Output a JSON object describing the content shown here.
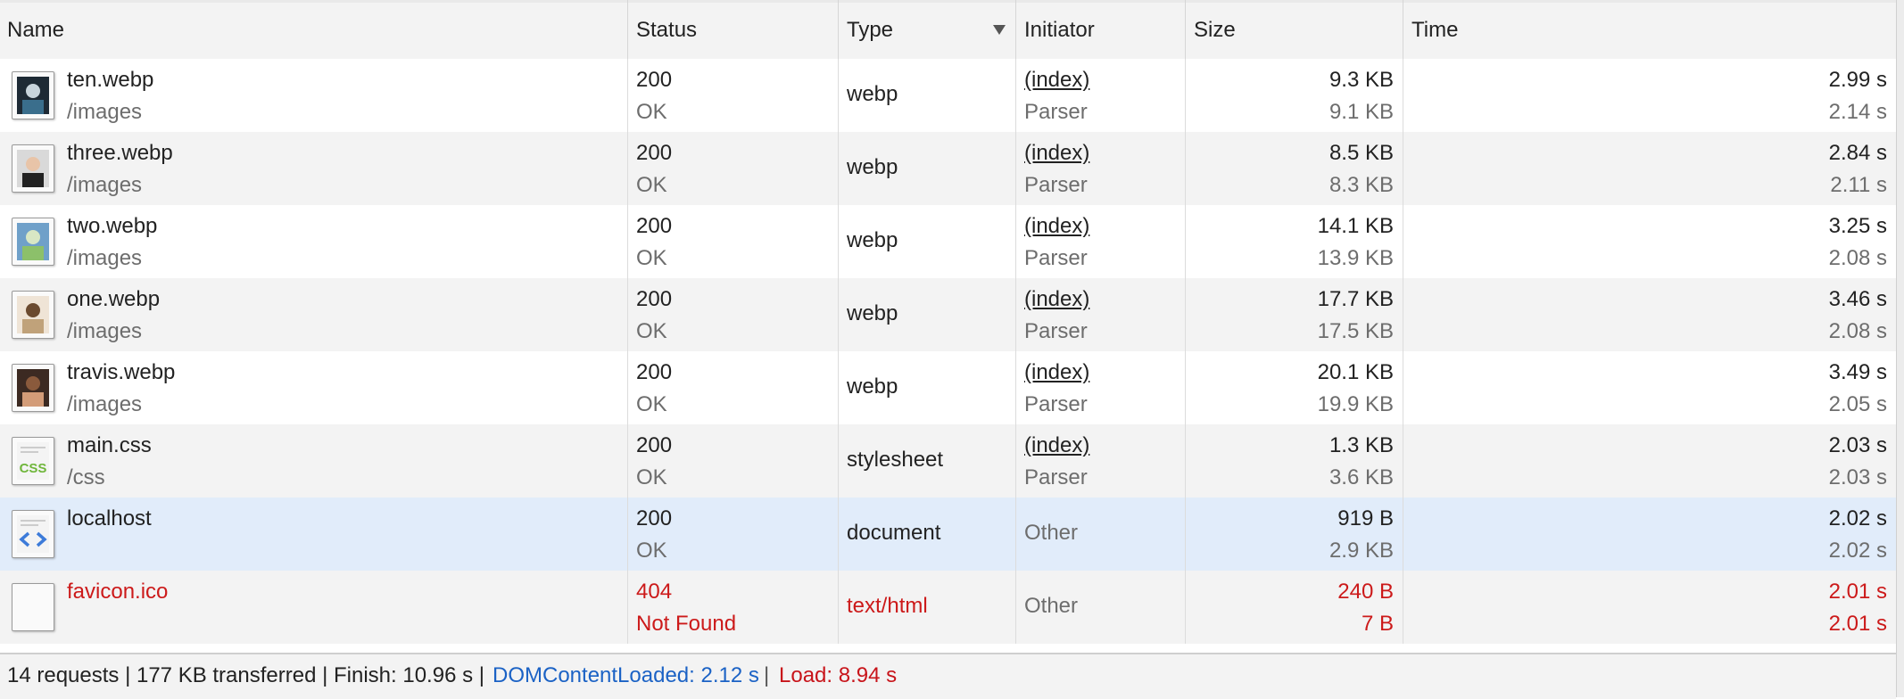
{
  "columns": {
    "name": "Name",
    "status": "Status",
    "type": "Type",
    "initiator": "Initiator",
    "size": "Size",
    "time": "Time"
  },
  "rows": [
    {
      "name": "ten.webp",
      "path": "/images",
      "status": "200",
      "status_text": "OK",
      "type": "webp",
      "initiator": "(index)",
      "initiator_type": "Parser",
      "size": "9.3 KB",
      "resource_size": "9.1 KB",
      "time": "2.99 s",
      "latency": "2.14 s",
      "icon": "image-thumbnail-icon"
    },
    {
      "name": "three.webp",
      "path": "/images",
      "status": "200",
      "status_text": "OK",
      "type": "webp",
      "initiator": "(index)",
      "initiator_type": "Parser",
      "size": "8.5 KB",
      "resource_size": "8.3 KB",
      "time": "2.84 s",
      "latency": "2.11 s",
      "icon": "image-thumbnail-icon"
    },
    {
      "name": "two.webp",
      "path": "/images",
      "status": "200",
      "status_text": "OK",
      "type": "webp",
      "initiator": "(index)",
      "initiator_type": "Parser",
      "size": "14.1 KB",
      "resource_size": "13.9 KB",
      "time": "3.25 s",
      "latency": "2.08 s",
      "icon": "image-thumbnail-icon"
    },
    {
      "name": "one.webp",
      "path": "/images",
      "status": "200",
      "status_text": "OK",
      "type": "webp",
      "initiator": "(index)",
      "initiator_type": "Parser",
      "size": "17.7 KB",
      "resource_size": "17.5 KB",
      "time": "3.46 s",
      "latency": "2.08 s",
      "icon": "image-thumbnail-icon"
    },
    {
      "name": "travis.webp",
      "path": "/images",
      "status": "200",
      "status_text": "OK",
      "type": "webp",
      "initiator": "(index)",
      "initiator_type": "Parser",
      "size": "20.1 KB",
      "resource_size": "19.9 KB",
      "time": "3.49 s",
      "latency": "2.05 s",
      "icon": "image-thumbnail-icon"
    },
    {
      "name": "main.css",
      "path": "/css",
      "status": "200",
      "status_text": "OK",
      "type": "stylesheet",
      "initiator": "(index)",
      "initiator_type": "Parser",
      "size": "1.3 KB",
      "resource_size": "3.6 KB",
      "time": "2.03 s",
      "latency": "2.03 s",
      "icon": "css-file-icon"
    },
    {
      "name": "localhost",
      "path": "",
      "status": "200",
      "status_text": "OK",
      "type": "document",
      "initiator": "Other",
      "size": "919 B",
      "resource_size": "2.9 KB",
      "time": "2.02 s",
      "latency": "2.02 s",
      "icon": "html-document-icon",
      "selected": true
    },
    {
      "name": "favicon.ico",
      "path": "",
      "status": "404",
      "status_text": "Not Found",
      "type": "text/html",
      "initiator": "Other",
      "size": "240 B",
      "resource_size": "7 B",
      "time": "2.01 s",
      "latency": "2.01 s",
      "icon": "blank-file-icon",
      "error": true
    }
  ],
  "footer": {
    "summary": "14 requests | 177 KB transferred | Finish: 10.96 s |",
    "dom_content_loaded": "DOMContentLoaded: 2.12 s",
    "separator": "|",
    "load": "Load: 8.94 s"
  },
  "colors": {
    "error": "#cc1a1a",
    "dom_content_loaded": "#1b62c5",
    "load": "#c8141a",
    "selected_row": "#e1ecfa"
  }
}
